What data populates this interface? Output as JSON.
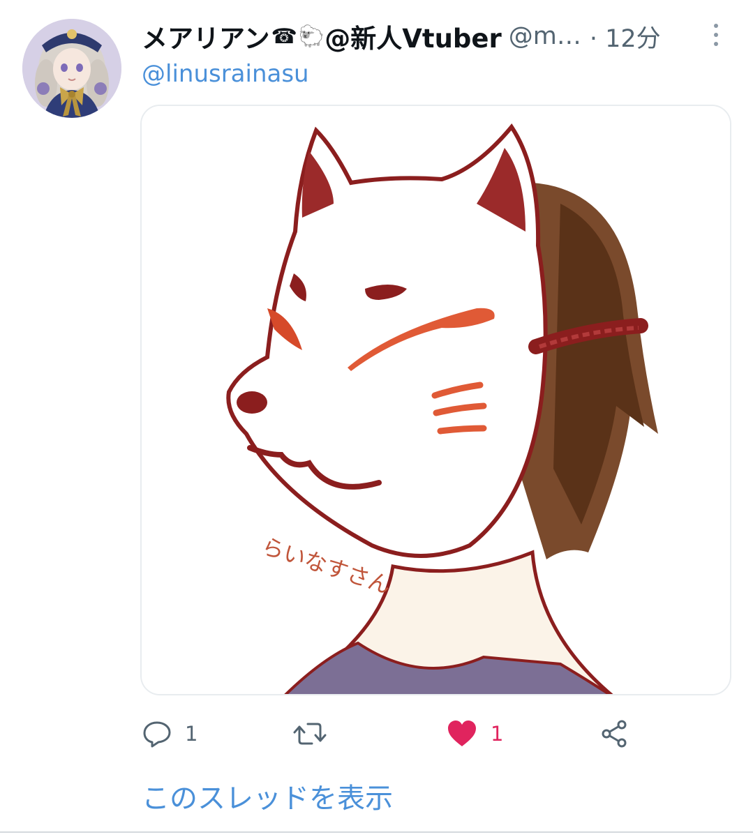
{
  "tweet": {
    "author": {
      "display_name": "メアリアン",
      "emoji_1": "☎",
      "emoji_2": "🐑",
      "name_suffix": "@新人Vtuber",
      "handle": "@m…",
      "time": "· 12分"
    },
    "reply_to": "@linusrainasu",
    "media": {
      "signature_text": "らいなすさん"
    },
    "actions": {
      "reply_count": "1",
      "like_count": "1"
    },
    "show_thread": "このスレッドを表示"
  },
  "colors": {
    "link": "#4a90d9",
    "like": "#e0245e",
    "muted": "#536471"
  }
}
